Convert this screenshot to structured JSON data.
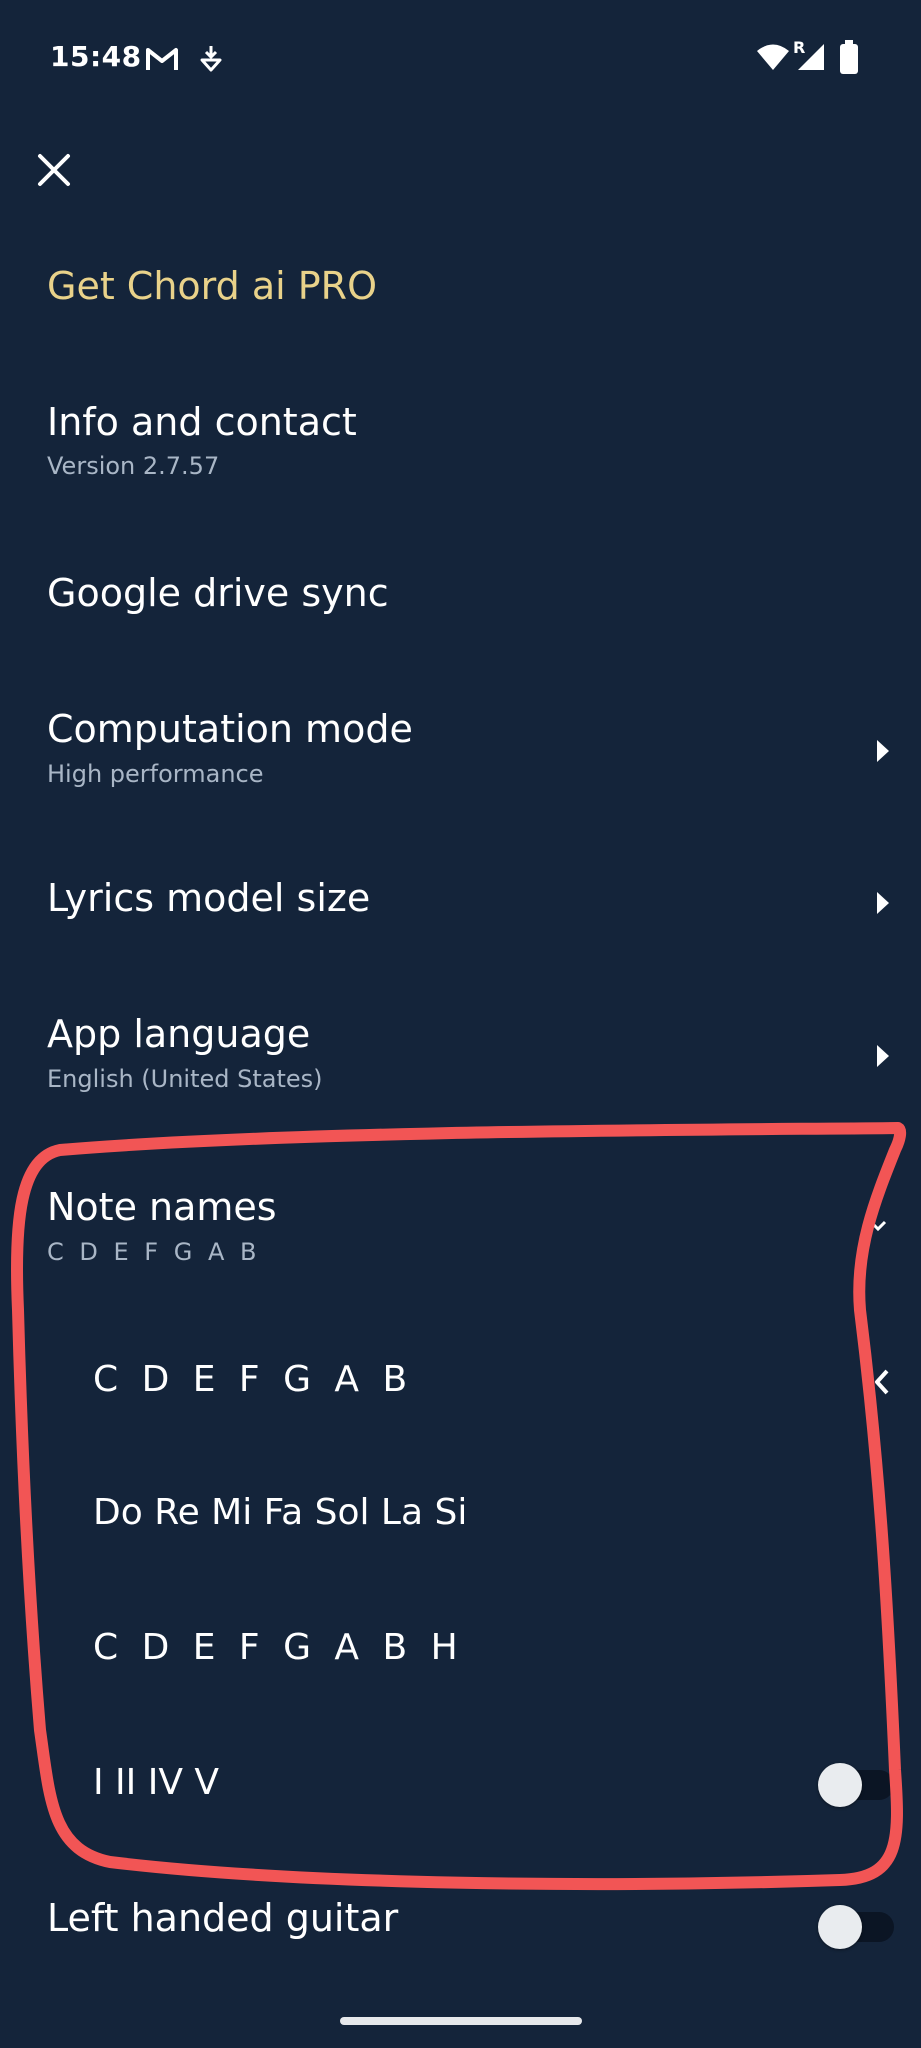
{
  "status_bar": {
    "time": "15:48",
    "left_icons": [
      "gmail-icon",
      "download-icon"
    ],
    "right_icons": [
      "wifi-icon",
      "signal-icon",
      "battery-icon"
    ],
    "roaming_label": "R"
  },
  "header": {
    "close_icon": "close-icon"
  },
  "menu": {
    "pro": {
      "label": "Get Chord ai PRO"
    },
    "info": {
      "title": "Info and contact",
      "subtitle": "Version 2.7.57"
    },
    "drive": {
      "title": "Google drive sync"
    },
    "computation": {
      "title": "Computation mode",
      "subtitle": "High performance"
    },
    "lyrics": {
      "title": "Lyrics model size"
    },
    "language": {
      "title": "App language",
      "subtitle": "English (United States)"
    },
    "note_names": {
      "title": "Note names",
      "subtitle": "C D E F G A B",
      "options": [
        "C D E F G A B",
        "Do Re Mi Fa Sol La Si",
        "C D E F G A B H",
        "I II IV V"
      ],
      "roman_toggle_on": false
    },
    "left_handed": {
      "title": "Left handed guitar",
      "toggle_on": false
    }
  },
  "colors": {
    "background": "#14243a",
    "accent_pro": "#e9d28a",
    "annotation": "#f25555"
  }
}
